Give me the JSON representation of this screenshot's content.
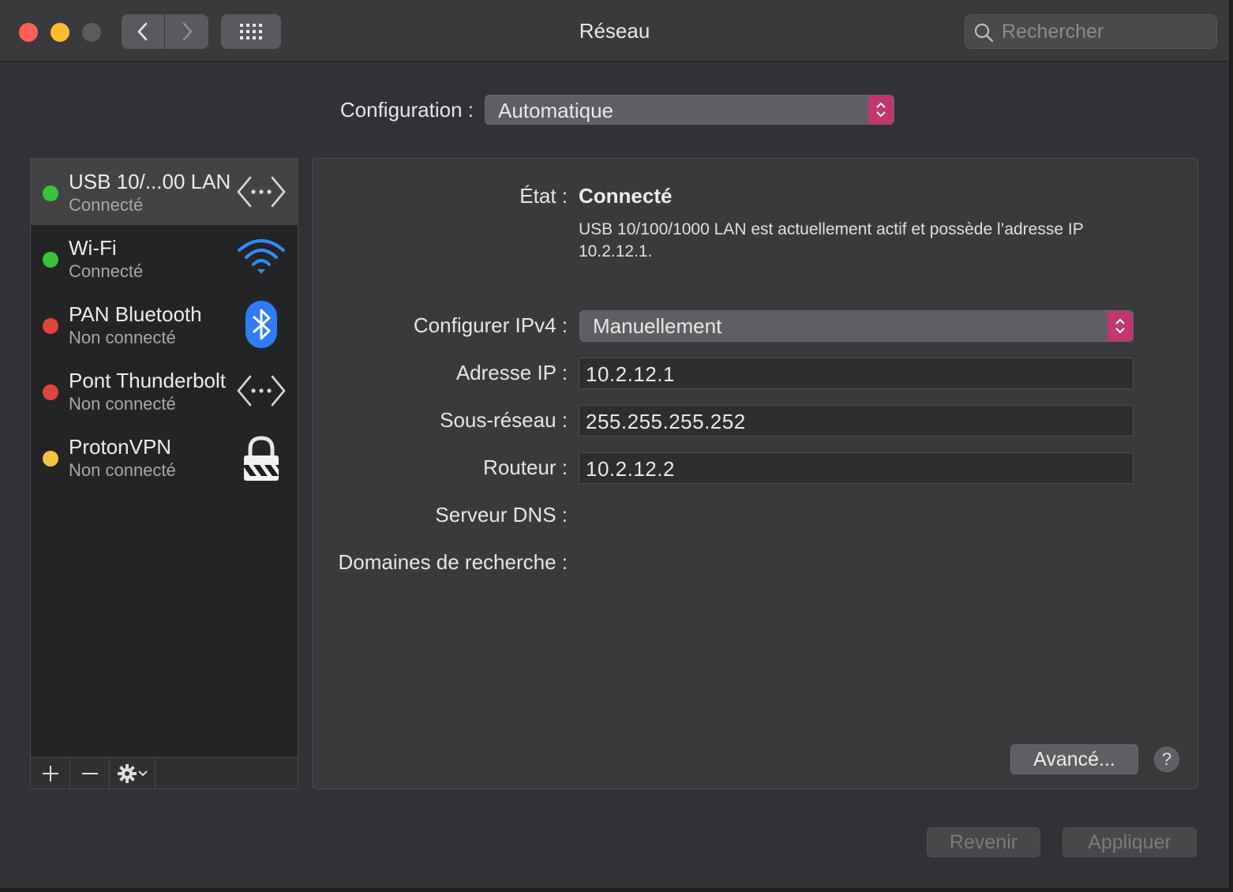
{
  "window": {
    "title": "Réseau"
  },
  "search": {
    "placeholder": "Rechercher"
  },
  "config": {
    "label": "Configuration :",
    "value": "Automatique"
  },
  "services": [
    {
      "name": "USB 10/...00 LAN",
      "status": "Connecté",
      "status_color": "green",
      "icon": "ethernet-arrows-icon",
      "selected": true
    },
    {
      "name": "Wi-Fi",
      "status": "Connecté",
      "status_color": "green",
      "icon": "wifi-icon",
      "selected": false
    },
    {
      "name": "PAN Bluetooth",
      "status": "Non connecté",
      "status_color": "red",
      "icon": "bluetooth-icon",
      "selected": false
    },
    {
      "name": "Pont Thunderbolt",
      "status": "Non connecté",
      "status_color": "red",
      "icon": "ethernet-arrows-icon",
      "selected": false
    },
    {
      "name": "ProtonVPN",
      "status": "Non connecté",
      "status_color": "yellow",
      "icon": "vpn-lock-icon",
      "selected": false
    }
  ],
  "detail": {
    "state_label": "État :",
    "state_value": "Connecté",
    "state_description": "USB 10/100/1000 LAN est actuellement actif et possède l’adresse IP 10.2.12.1.",
    "ipv4_label": "Configurer IPv4 :",
    "ipv4_value": "Manuellement",
    "ip_label": "Adresse IP :",
    "ip_value": "10.2.12.1",
    "subnet_label": "Sous-réseau :",
    "subnet_value": "255.255.255.252",
    "router_label": "Routeur :",
    "router_value": "10.2.12.2",
    "dns_label": "Serveur DNS :",
    "search_domains_label": "Domaines de recherche :",
    "advanced_label": "Avancé...",
    "help_label": "?"
  },
  "footer": {
    "revert_label": "Revenir",
    "apply_label": "Appliquer"
  },
  "colors": {
    "accent": "#c0366e",
    "status_green": "#3cc13f",
    "status_red": "#e0443e",
    "status_yellow": "#f5c243"
  }
}
